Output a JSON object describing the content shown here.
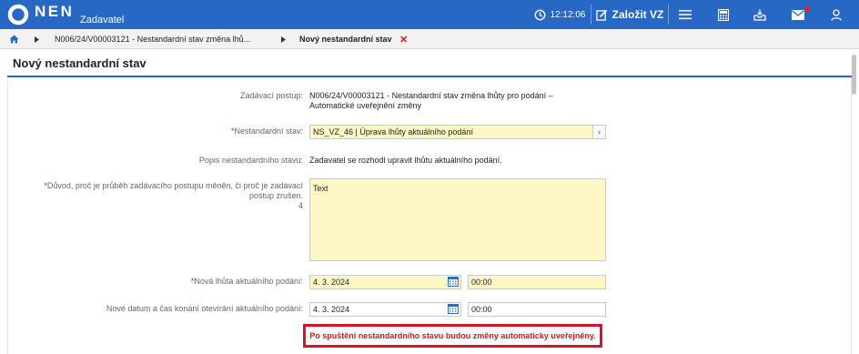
{
  "app": {
    "brand": "NEN",
    "role": "Zadavatel",
    "time": "12:12:06",
    "create_label": "Založit VZ"
  },
  "icons": {
    "logo": "nen-logo-icon",
    "clock": "clock-icon",
    "edit": "edit-icon",
    "menu": "menu-icon",
    "calculator": "calculator-icon",
    "inbox": "inbox-download-icon",
    "mail": "mail-icon",
    "user": "user-icon",
    "home": "home-icon",
    "calendar": "calendar-icon"
  },
  "colors": {
    "brand_blue": "#2668c4",
    "required_red": "#d3152a",
    "field_yellow": "#fdf6c5",
    "notification_dot": "#e52027"
  },
  "breadcrumb": {
    "items": [
      "N006/24/V00003121 - Nestandardní stav změna lhů...",
      "Nový nestandardní stav"
    ],
    "close": "✕"
  },
  "page": {
    "title": "Nový nestandardní stav"
  },
  "form": {
    "procedure": {
      "label": "Zadávací postup:",
      "value_line1": "N006/24/V00003121 - Nestandardní stav změna lhůty pro podání –",
      "value_line2": "Automatické uveřejnění změny"
    },
    "state": {
      "required_mark": "*",
      "label": "Nestandardní stav:",
      "value": "NS_VZ_46 | Úprava lhůty aktuálního podání",
      "arrow": "›"
    },
    "description": {
      "label": "Popis nestandardního stavu:",
      "value": "Zadavatel se rozhodl upravit lhůtu aktuálního podání."
    },
    "reason": {
      "required_mark": "*",
      "label_line1": "Důvod, proč je průběh zadávacího postupu měněn, či proč je zadávací",
      "label_line2": "postup zrušen.",
      "counter": "4",
      "value": "Text"
    },
    "new_deadline": {
      "required_mark": "*",
      "label": "Nová lhůta aktuálního podání:",
      "date": "4. 3. 2024",
      "time": "00:00"
    },
    "opening": {
      "label": "Nové datum a čas konání otevírání aktuálního podání:",
      "date": "4. 3. 2024",
      "time": "00:00"
    }
  },
  "warning": "Po spuštění nestandardního stavu budou změny automaticky uveřejněny."
}
